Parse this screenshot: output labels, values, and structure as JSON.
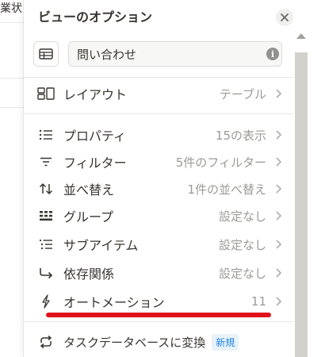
{
  "background": {
    "partial_text": "業状"
  },
  "panel": {
    "title": "ビューのオプション",
    "view_name": {
      "value": "問い合わせ",
      "placeholder": ""
    },
    "layout": {
      "label": "レイアウト",
      "value": "テーブル"
    },
    "items": [
      {
        "icon": "list-icon",
        "label": "プロパティ",
        "value": "15の表示"
      },
      {
        "icon": "filter-icon",
        "label": "フィルター",
        "value": "5件のフィルター"
      },
      {
        "icon": "sort-icon",
        "label": "並べ替え",
        "value": "1件の並べ替え"
      },
      {
        "icon": "group-icon",
        "label": "グループ",
        "value": "設定なし"
      },
      {
        "icon": "subitem-icon",
        "label": "サブアイテム",
        "value": "設定なし"
      },
      {
        "icon": "dependency-icon",
        "label": "依存関係",
        "value": "設定なし"
      },
      {
        "icon": "lightning-icon",
        "label": "オートメーション",
        "value": "11"
      }
    ],
    "convert": {
      "label": "タスクデータベースに変換",
      "badge": "新規"
    }
  },
  "colors": {
    "accent_underline": "#e0121b",
    "badge_text": "#2383e2",
    "muted_text": "#9b9a97",
    "scrollbar_thumb": "#d3d1cb"
  }
}
